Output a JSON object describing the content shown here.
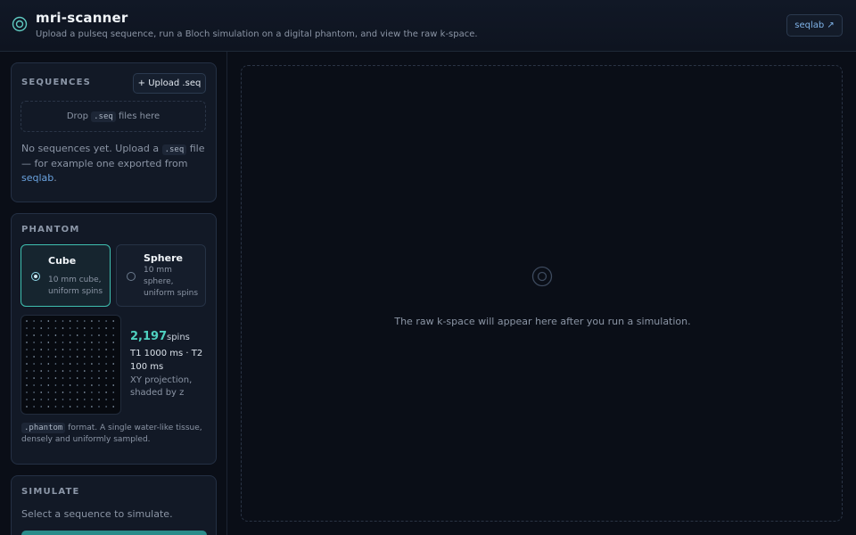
{
  "header": {
    "logo_icon": "radio-target-icon",
    "title": "mri-scanner",
    "subtitle": "Upload a pulseq sequence, run a Bloch simulation on a digital phantom, and view the raw k-space.",
    "link_label": "seqlab ↗"
  },
  "sequences": {
    "title": "SEQUENCES",
    "upload_label": "+ Upload .seq",
    "drop_prefix": "Drop",
    "drop_code": ".seq",
    "drop_suffix": "files here",
    "empty_prefix": "No sequences yet. Upload a",
    "empty_code": ".seq",
    "empty_middle": "file — for example one exported from",
    "empty_link": "seqlab",
    "empty_end": "."
  },
  "phantom": {
    "title": "PHANTOM",
    "options": [
      {
        "name": "Cube",
        "desc": "10 mm cube, uniform spins",
        "selected": true
      },
      {
        "name": "Sphere",
        "desc": "10 mm sphere, uniform spins",
        "selected": false
      }
    ],
    "spin_count": "2,197",
    "spin_unit": "spins",
    "relaxation": "T1 1000 ms · T2 100 ms",
    "projection": "XY projection, shaded by z",
    "format_code": ".phantom",
    "format_text": "format. A single water-like tissue, densely and uniformly sampled."
  },
  "simulate": {
    "title": "SIMULATE",
    "hint": "Select a sequence to simulate."
  },
  "main": {
    "icon": "target-icon",
    "message": "The raw k-space will appear here after you run a simulation."
  },
  "colors": {
    "accent": "#4fd1c0",
    "link": "#6aa3e0",
    "background": "#0a0e17"
  }
}
